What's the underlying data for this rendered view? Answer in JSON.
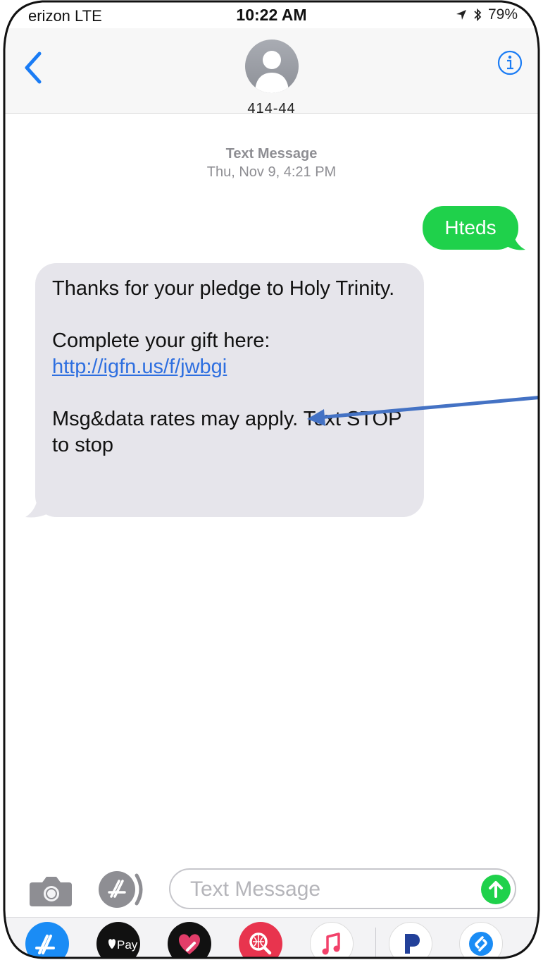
{
  "status_bar": {
    "carrier": "erizon  LTE",
    "time": "10:22 AM",
    "battery": "79%"
  },
  "header": {
    "contact_number": "414-44",
    "back_icon": "chevron-left-icon",
    "info_icon": "info-icon",
    "accent_color": "#1a7cf5"
  },
  "conversation": {
    "timestamp_label": "Text Message",
    "timestamp_date": "Thu, Nov 9, 4:21 PM",
    "outgoing_message": "Hteds",
    "outgoing_color": "#1fd14b",
    "incoming_color": "#e6e5eb",
    "incoming": {
      "line1": "Thanks for your pledge to Holy Trinity.",
      "line2": "Complete your gift here:",
      "link": "http://igfn.us/f/jwbgi",
      "line3": "Msg&data rates may apply. Text STOP to stop"
    }
  },
  "input_bar": {
    "placeholder": "Text Message",
    "value": "",
    "camera_icon": "camera-icon",
    "app_icon": "app-store-icon",
    "send_icon": "arrow-up-icon"
  },
  "app_drawer": {
    "apple_pay_label": "Pay",
    "apps": [
      "app-store-icon",
      "apple-pay-icon",
      "digital-touch-icon",
      "web-search-icon",
      "music-icon",
      "pandora-icon",
      "shazam-icon"
    ]
  }
}
